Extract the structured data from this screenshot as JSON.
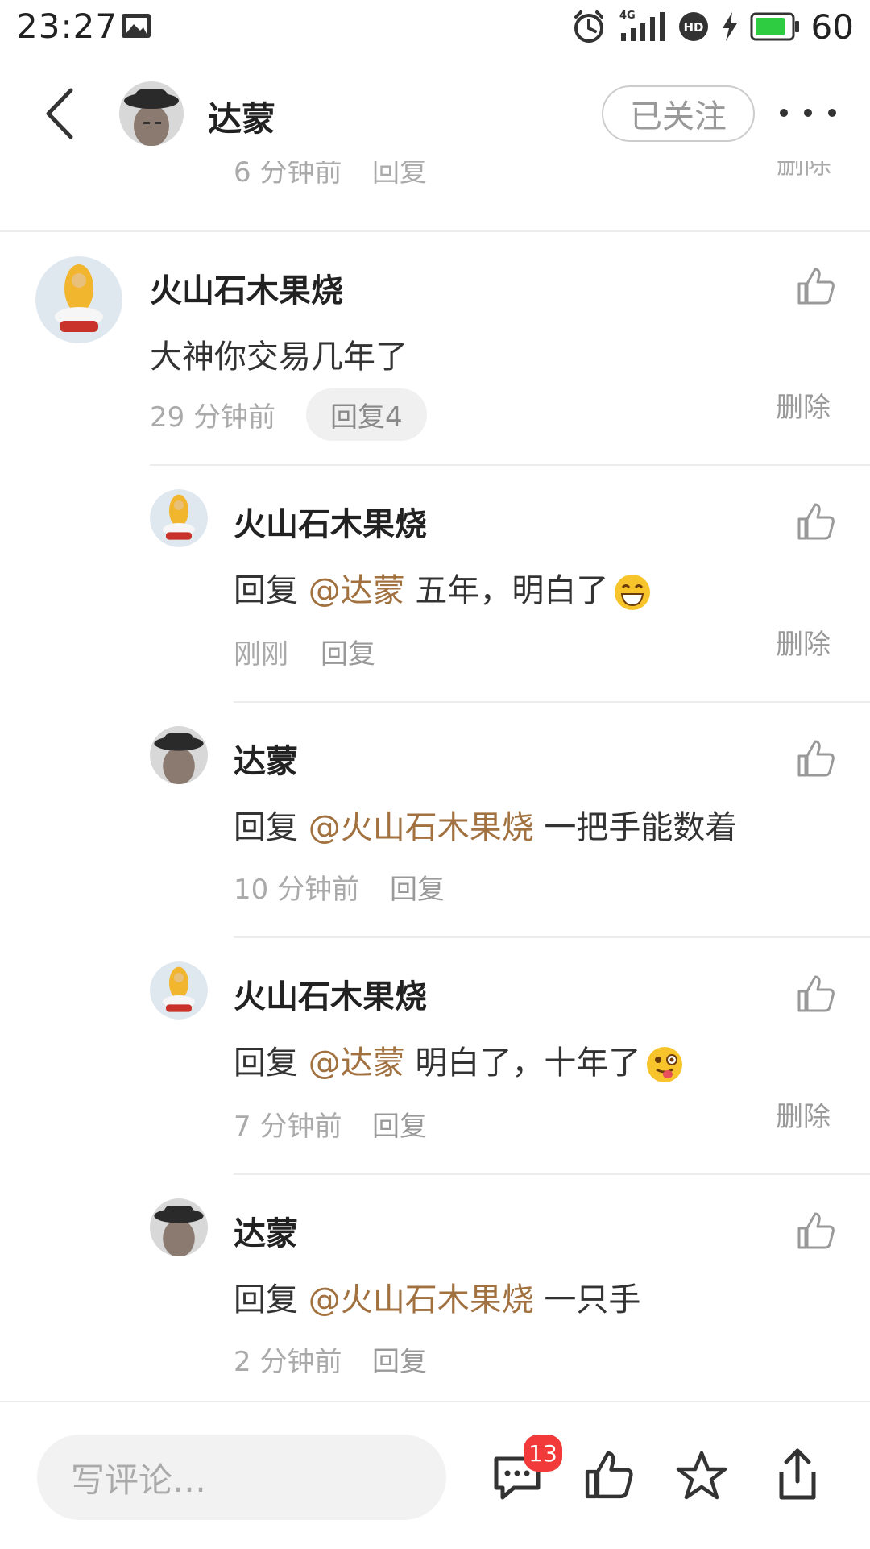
{
  "status_bar": {
    "time": "23:27",
    "battery": "60",
    "network": "4G"
  },
  "nav": {
    "title": "达蒙",
    "follow_label": "已关注"
  },
  "clipped_row": {
    "time": "6 分钟前",
    "reply": "回复",
    "delete": "删除"
  },
  "main_comment": {
    "author": "火山石木果烧",
    "text": "大神你交易几年了",
    "time": "29 分钟前",
    "reply_label": "回复4",
    "delete_label": "删除"
  },
  "replies": [
    {
      "author": "火山石木果烧",
      "prefix": "回复 ",
      "mention": "@达蒙",
      "text": " 五年，明白了",
      "emoji": "grinning",
      "time": "刚刚",
      "reply_label": "回复",
      "delete_label": "删除"
    },
    {
      "author": "达蒙",
      "prefix": "回复 ",
      "mention": "@火山石木果烧",
      "text": " 一把手能数着",
      "emoji": "",
      "time": "10 分钟前",
      "reply_label": "回复",
      "delete_label": ""
    },
    {
      "author": "火山石木果烧",
      "prefix": "回复 ",
      "mention": "@达蒙",
      "text": " 明白了，十年了",
      "emoji": "winking-tongue",
      "time": "7 分钟前",
      "reply_label": "回复",
      "delete_label": "删除"
    },
    {
      "author": "达蒙",
      "prefix": "回复 ",
      "mention": "@火山石木果烧",
      "text": " 一只手",
      "emoji": "",
      "time": "2 分钟前",
      "reply_label": "回复",
      "delete_label": ""
    }
  ],
  "bottom_bar": {
    "placeholder": "写评论…",
    "comment_count": "13"
  },
  "colors": {
    "mention": "#a27140",
    "badge": "#f23a3a",
    "battery": "#2ecc40"
  },
  "icons": [
    "back-icon",
    "more-icon",
    "like-icon",
    "comment-icon",
    "star-icon",
    "share-icon",
    "alarm-icon",
    "signal-icon",
    "hd-icon",
    "charging-icon",
    "battery-icon",
    "image-notification-icon"
  ]
}
